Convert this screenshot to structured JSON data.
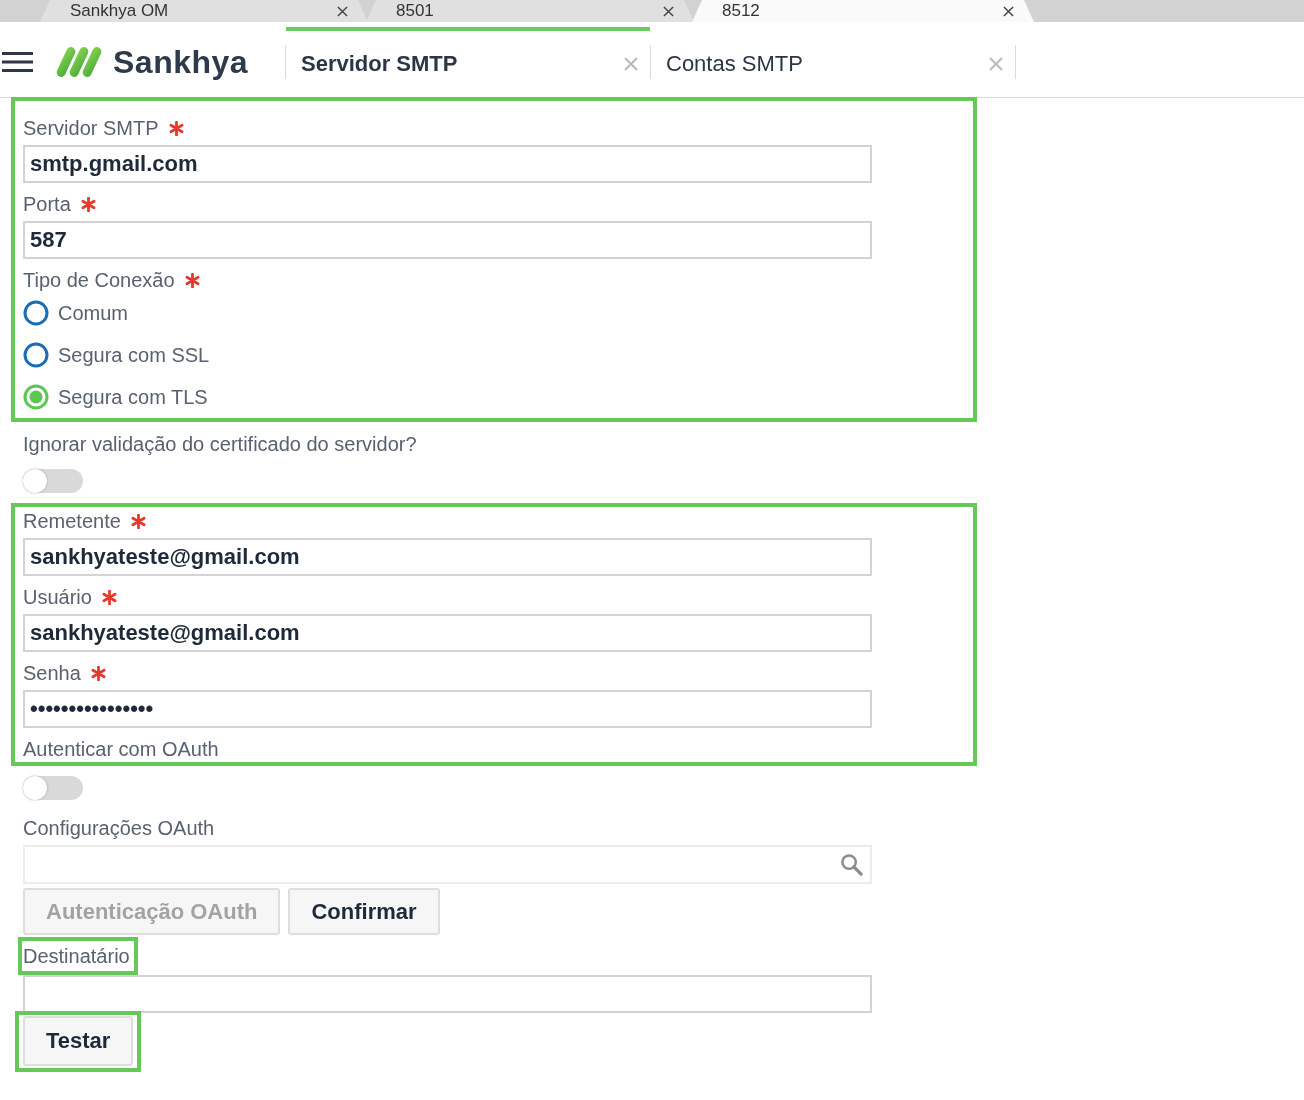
{
  "browser_tabs": [
    {
      "label": "Sankhya OM",
      "selected": false
    },
    {
      "label": "8501",
      "selected": false
    },
    {
      "label": "8512",
      "selected": true
    }
  ],
  "app_header": {
    "brand": "Sankhya",
    "tabs": [
      {
        "label": "Servidor SMTP",
        "selected": true
      },
      {
        "label": "Contas SMTP",
        "selected": false
      }
    ]
  },
  "form": {
    "sections": [
      {
        "highlighted": true,
        "items": [
          {
            "kind": "label",
            "text": "Servidor SMTP",
            "required": true
          },
          {
            "kind": "input",
            "value": "smtp.gmail.com"
          },
          {
            "kind": "label",
            "text": "Porta",
            "required": true
          },
          {
            "kind": "input",
            "value": "587"
          },
          {
            "kind": "label",
            "text": "Tipo de Conexão",
            "required": true
          },
          {
            "kind": "radio_group",
            "options": [
              {
                "label": "Comum",
                "selected": false
              },
              {
                "label": "Segura com SSL",
                "selected": false
              },
              {
                "label": "Segura com TLS",
                "selected": true
              }
            ]
          }
        ]
      },
      {
        "highlighted": false,
        "items": [
          {
            "kind": "label",
            "text": "Ignorar validação do certificado do servidor?",
            "required": false
          },
          {
            "kind": "switch",
            "on": false
          }
        ]
      },
      {
        "highlighted": true,
        "items": [
          {
            "kind": "label",
            "text": "Remetente",
            "required": true
          },
          {
            "kind": "input",
            "value": "sankhyateste@gmail.com"
          },
          {
            "kind": "label",
            "text": "Usuário",
            "required": true
          },
          {
            "kind": "input",
            "value": "sankhyateste@gmail.com"
          },
          {
            "kind": "label",
            "text": "Senha",
            "required": true
          },
          {
            "kind": "password",
            "value": "••••••••••••••••"
          },
          {
            "kind": "label",
            "text": "Autenticar com OAuth",
            "required": false
          }
        ]
      },
      {
        "highlighted": false,
        "items": [
          {
            "kind": "switch",
            "on": false
          },
          {
            "kind": "label",
            "text": "Configurações OAuth",
            "required": false
          },
          {
            "kind": "search"
          },
          {
            "kind": "buttons",
            "buttons": [
              {
                "label": "Autenticação OAuth",
                "disabled": true
              },
              {
                "label": "Confirmar",
                "disabled": false
              }
            ]
          }
        ]
      },
      {
        "highlighted": true,
        "items": [
          {
            "kind": "label",
            "text": "Destinatário",
            "required": false
          }
        ]
      },
      {
        "highlighted": false,
        "items": [
          {
            "kind": "input"
          }
        ]
      },
      {
        "highlighted": true,
        "items": [
          {
            "kind": "buttons",
            "buttons": [
              {
                "label": "Testar",
                "disabled": false
              }
            ]
          }
        ]
      }
    ]
  }
}
